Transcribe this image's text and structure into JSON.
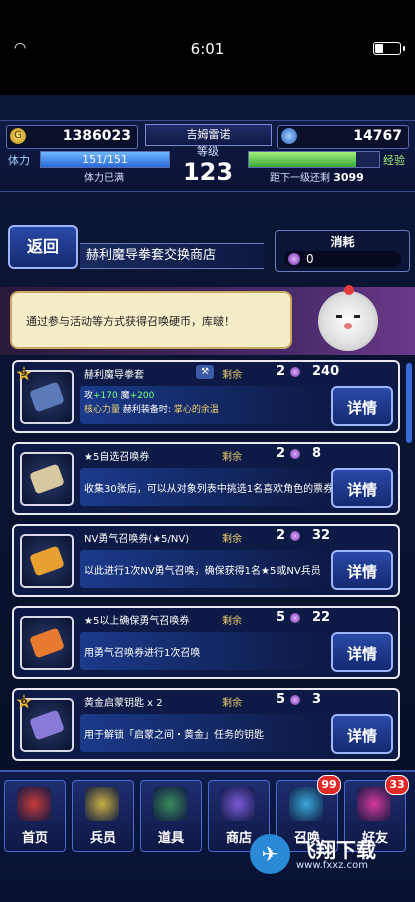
{
  "status": {
    "time": "6:01",
    "wifi_icon": "wifi-icon",
    "battery_icon": "battery-icon"
  },
  "header": {
    "gold": "1386023",
    "gems": "14767",
    "player_name": "吉姆雷诺",
    "level_label": "等级",
    "level": "123",
    "stamina_label": "体力",
    "stamina": "151/151",
    "stamina_progress": 1.0,
    "stamina_note": "体力已满",
    "exp_label": "经验",
    "exp_progress": 0.82,
    "exp_note": "距下一级还剩",
    "exp_remaining": "3099"
  },
  "shop": {
    "back_label": "返回",
    "title": "赫利魔导拳套交换商店",
    "cost_label": "消耗",
    "cost_value": "0",
    "npc_message": "通过参与活动等方式获得召唤硬币，库啵！"
  },
  "items": [
    {
      "star": "9",
      "name": "赫利魔导拳套",
      "remain_label": "剩余",
      "remain": "2",
      "price": "240",
      "stat_prefix": "攻",
      "stat_atk": "+170",
      "stat_mag_label": "魔",
      "stat_mag": "+200",
      "core_label": "核心力量",
      "core_text": "赫利装备时:",
      "core_skill": "掌心的余温",
      "detail_label": "详情",
      "art_color": "#5a7ab8"
    },
    {
      "name": "★5自选召唤券",
      "remain_label": "剩余",
      "remain": "2",
      "price": "8",
      "desc": "收集30张后，可以从对象列表中挑选1名喜欢角色的票券",
      "detail_label": "详情",
      "art_color": "#d8c8a0"
    },
    {
      "name": "NV勇气召唤券(★5/NV)",
      "remain_label": "剩余",
      "remain": "2",
      "price": "32",
      "desc": "以此进行1次NV勇气召唤，确保获得1名★5或NV兵员",
      "detail_label": "详情",
      "art_color": "#e8a030"
    },
    {
      "name": "★5以上确保勇气召唤券",
      "remain_label": "剩余",
      "remain": "5",
      "price": "22",
      "desc": "用勇气召唤券进行1次召唤",
      "detail_label": "详情",
      "art_color": "#e87a30"
    },
    {
      "star": "6",
      "name": "黄金启蒙钥匙 x 2",
      "remain_label": "剩余",
      "remain": "5",
      "price": "3",
      "desc": "用于解锁「启蒙之间・黄金」任务的钥匙",
      "detail_label": "详情",
      "art_color": "#8a7ad8"
    }
  ],
  "nav": [
    {
      "label": "首页",
      "icon": "home-icon",
      "color": "#c83a3a"
    },
    {
      "label": "兵员",
      "icon": "units-icon",
      "color": "#c8b040"
    },
    {
      "label": "道具",
      "icon": "items-icon",
      "color": "#3a8a5a"
    },
    {
      "label": "商店",
      "icon": "shop-icon",
      "color": "#7a5ad8"
    },
    {
      "label": "召唤",
      "icon": "summon-icon",
      "color": "#3aa8d8",
      "badge": "99"
    },
    {
      "label": "好友",
      "icon": "friends-icon",
      "color": "#d83a9a",
      "badge": "33"
    }
  ],
  "watermark": {
    "text": "飞翔下载",
    "url": "www.fxxz.com"
  }
}
